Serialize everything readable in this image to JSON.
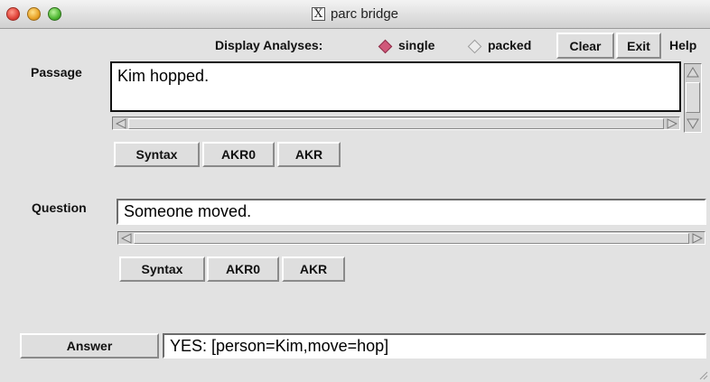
{
  "window": {
    "title": "parc bridge",
    "title_icon": "x11-icon"
  },
  "toolbar": {
    "display_label": "Display Analyses:",
    "modes": [
      {
        "label": "single",
        "selected": true
      },
      {
        "label": "packed",
        "selected": false
      }
    ],
    "clear_label": "Clear",
    "exit_label": "Exit",
    "help_label": "Help"
  },
  "passage": {
    "label": "Passage",
    "value": "Kim hopped.",
    "buttons": [
      "Syntax",
      "AKR0",
      "AKR"
    ]
  },
  "question": {
    "label": "Question",
    "value": "Someone moved.",
    "buttons": [
      "Syntax",
      "AKR0",
      "AKR"
    ]
  },
  "answer": {
    "button_label": "Answer",
    "value": "YES:  [person=Kim,move=hop]"
  },
  "colors": {
    "radio_selected": "#d0587a",
    "window_bg": "#e2e2e2"
  }
}
